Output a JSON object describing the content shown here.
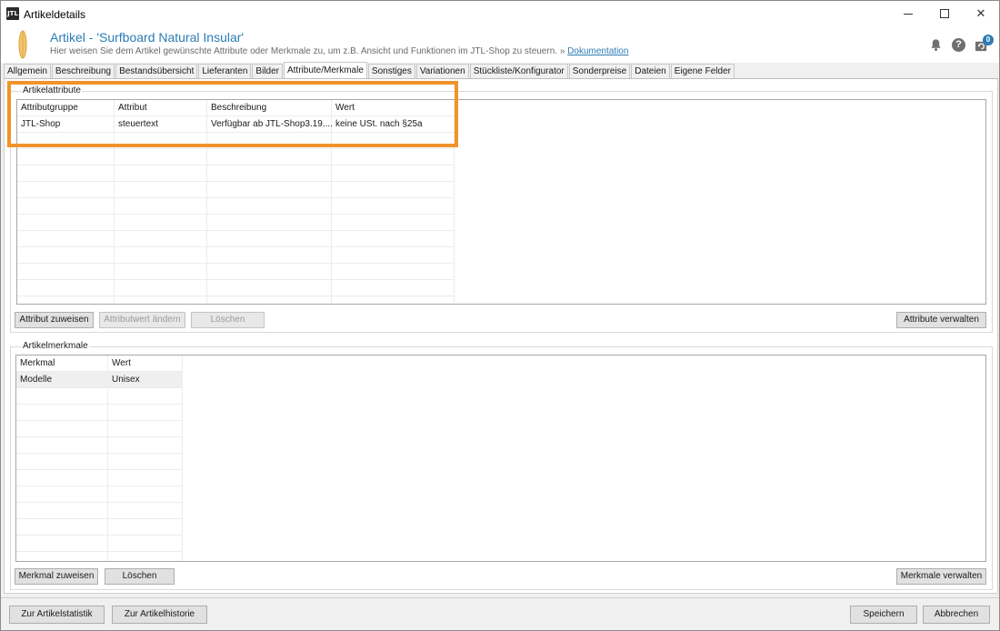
{
  "window": {
    "title": "Artikeldetails",
    "icon_name": "jtl-app-icon",
    "icon_text": "JTL"
  },
  "header": {
    "title": "Artikel - 'Surfboard Natural Insular'",
    "subtitle": "Hier weisen Sie dem Artikel gewünschte Attribute oder Merkmale zu, um z.B. Ansicht und Funktionen im JTL-Shop zu steuern. » ",
    "doc_link": "Dokumentation",
    "notification_count": "0"
  },
  "tabs": [
    {
      "label": "Allgemein",
      "active": false
    },
    {
      "label": "Beschreibung",
      "active": false
    },
    {
      "label": "Bestandsübersicht",
      "active": false
    },
    {
      "label": "Lieferanten",
      "active": false
    },
    {
      "label": "Bilder",
      "active": false
    },
    {
      "label": "Attribute/Merkmale",
      "active": true
    },
    {
      "label": "Sonstiges",
      "active": false
    },
    {
      "label": "Variationen",
      "active": false
    },
    {
      "label": "Stückliste/Konfigurator",
      "active": false
    },
    {
      "label": "Sonderpreise",
      "active": false
    },
    {
      "label": "Dateien",
      "active": false
    },
    {
      "label": "Eigene Felder",
      "active": false
    }
  ],
  "attributes": {
    "group_label": "Artikelattribute",
    "columns": [
      "Attributgruppe",
      "Attribut",
      "Beschreibung",
      "Wert"
    ],
    "rows": [
      [
        "JTL-Shop",
        "steuertext",
        "Verfügbar ab JTL-Shop3.19....",
        "keine USt. nach §25a"
      ]
    ],
    "buttons": {
      "assign": "Attribut zuweisen",
      "change": "Attributwert ändern",
      "delete": "Löschen",
      "manage": "Attribute verwalten"
    }
  },
  "features": {
    "group_label": "Artikelmerkmale",
    "columns": [
      "Merkmal",
      "Wert"
    ],
    "rows": [
      [
        "Modelle",
        "Unisex"
      ]
    ],
    "buttons": {
      "assign": "Merkmal zuweisen",
      "delete": "Löschen",
      "manage": "Merkmale verwalten"
    }
  },
  "footer": {
    "stats": "Zur Artikelstatistik",
    "history": "Zur Artikelhistorie",
    "save": "Speichern",
    "cancel": "Abbrechen"
  },
  "colors": {
    "accent": "#2b7cb3",
    "highlight": "#f0932b"
  }
}
